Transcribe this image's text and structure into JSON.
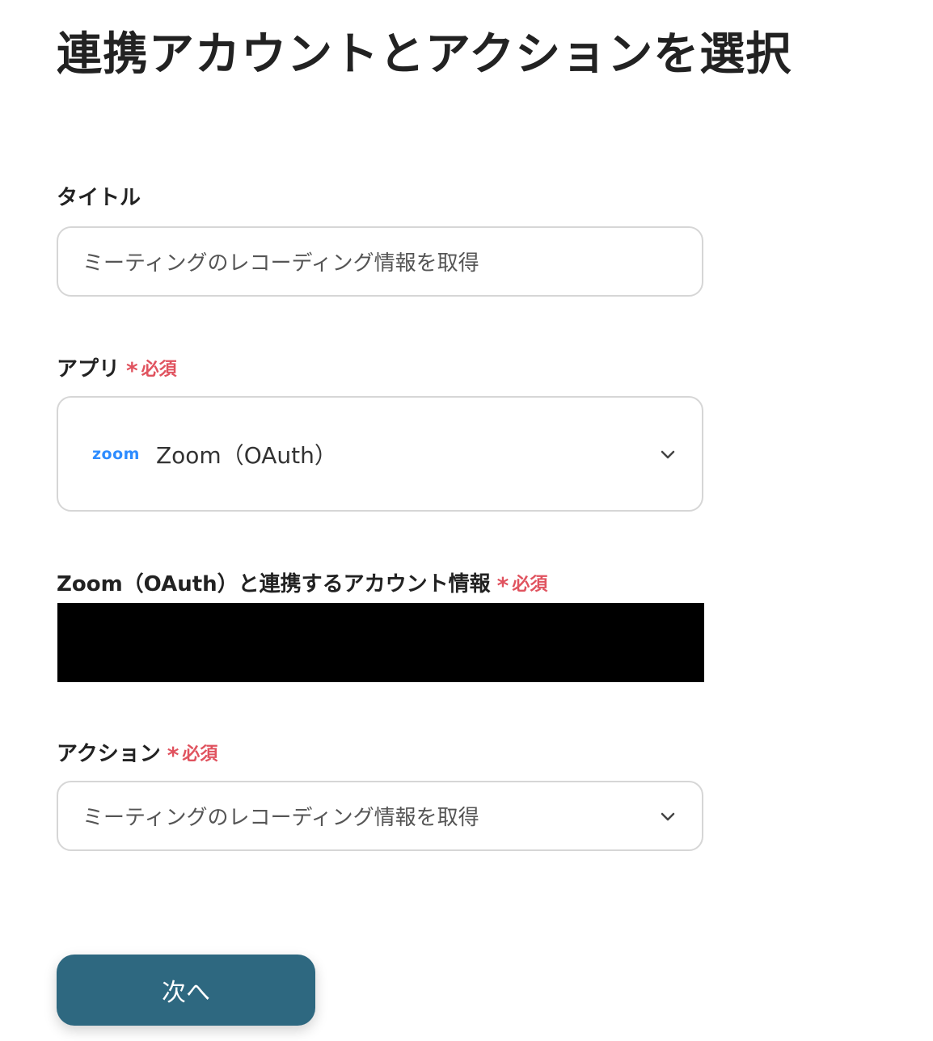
{
  "page": {
    "title": "連携アカウントとアクションを選択"
  },
  "title_field": {
    "label": "タイトル",
    "value": "ミーティングのレコーディング情報を取得"
  },
  "app_field": {
    "label": "アプリ",
    "required_mark": "*",
    "required_text": "必須",
    "logo_text": "zoom",
    "value": "Zoom（OAuth）"
  },
  "account_field": {
    "label": "Zoom（OAuth）と連携するアカウント情報",
    "required_mark": "*",
    "required_text": "必須"
  },
  "action_field": {
    "label": "アクション",
    "required_mark": "*",
    "required_text": "必須",
    "value": "ミーティングのレコーディング情報を取得"
  },
  "footer": {
    "next_label": "次へ"
  },
  "colors": {
    "primary_button": "#2e6880",
    "required": "#e0535f",
    "zoom_brand": "#2d8cff",
    "border": "#d6d6d6"
  }
}
